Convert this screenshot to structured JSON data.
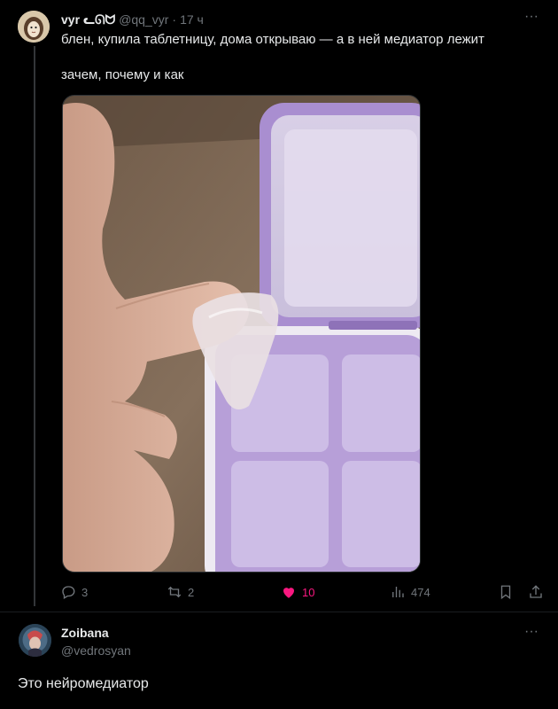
{
  "post": {
    "display_name": "vyr ᓚᘏᗢ",
    "handle": "@qq_vyr",
    "separator": "·",
    "time": "17 ч",
    "text_line1": "блен, купила таблетницу, дома открываю — а в ней медиатор лежит",
    "text_line2": "зачем, почему и как",
    "more_label": "···",
    "stats": {
      "replies": "3",
      "retweets": "2",
      "likes": "10",
      "views": "474"
    },
    "like_color": "#f91880"
  },
  "reply": {
    "display_name": "Zoibana",
    "handle": "@vedrosyan",
    "text": "Это нейромедиатор",
    "more_label": "···"
  },
  "icons": {
    "reply": "reply-icon",
    "retweet": "retweet-icon",
    "like": "heart-icon",
    "views": "views-icon",
    "bookmark": "bookmark-icon",
    "share": "share-icon"
  }
}
